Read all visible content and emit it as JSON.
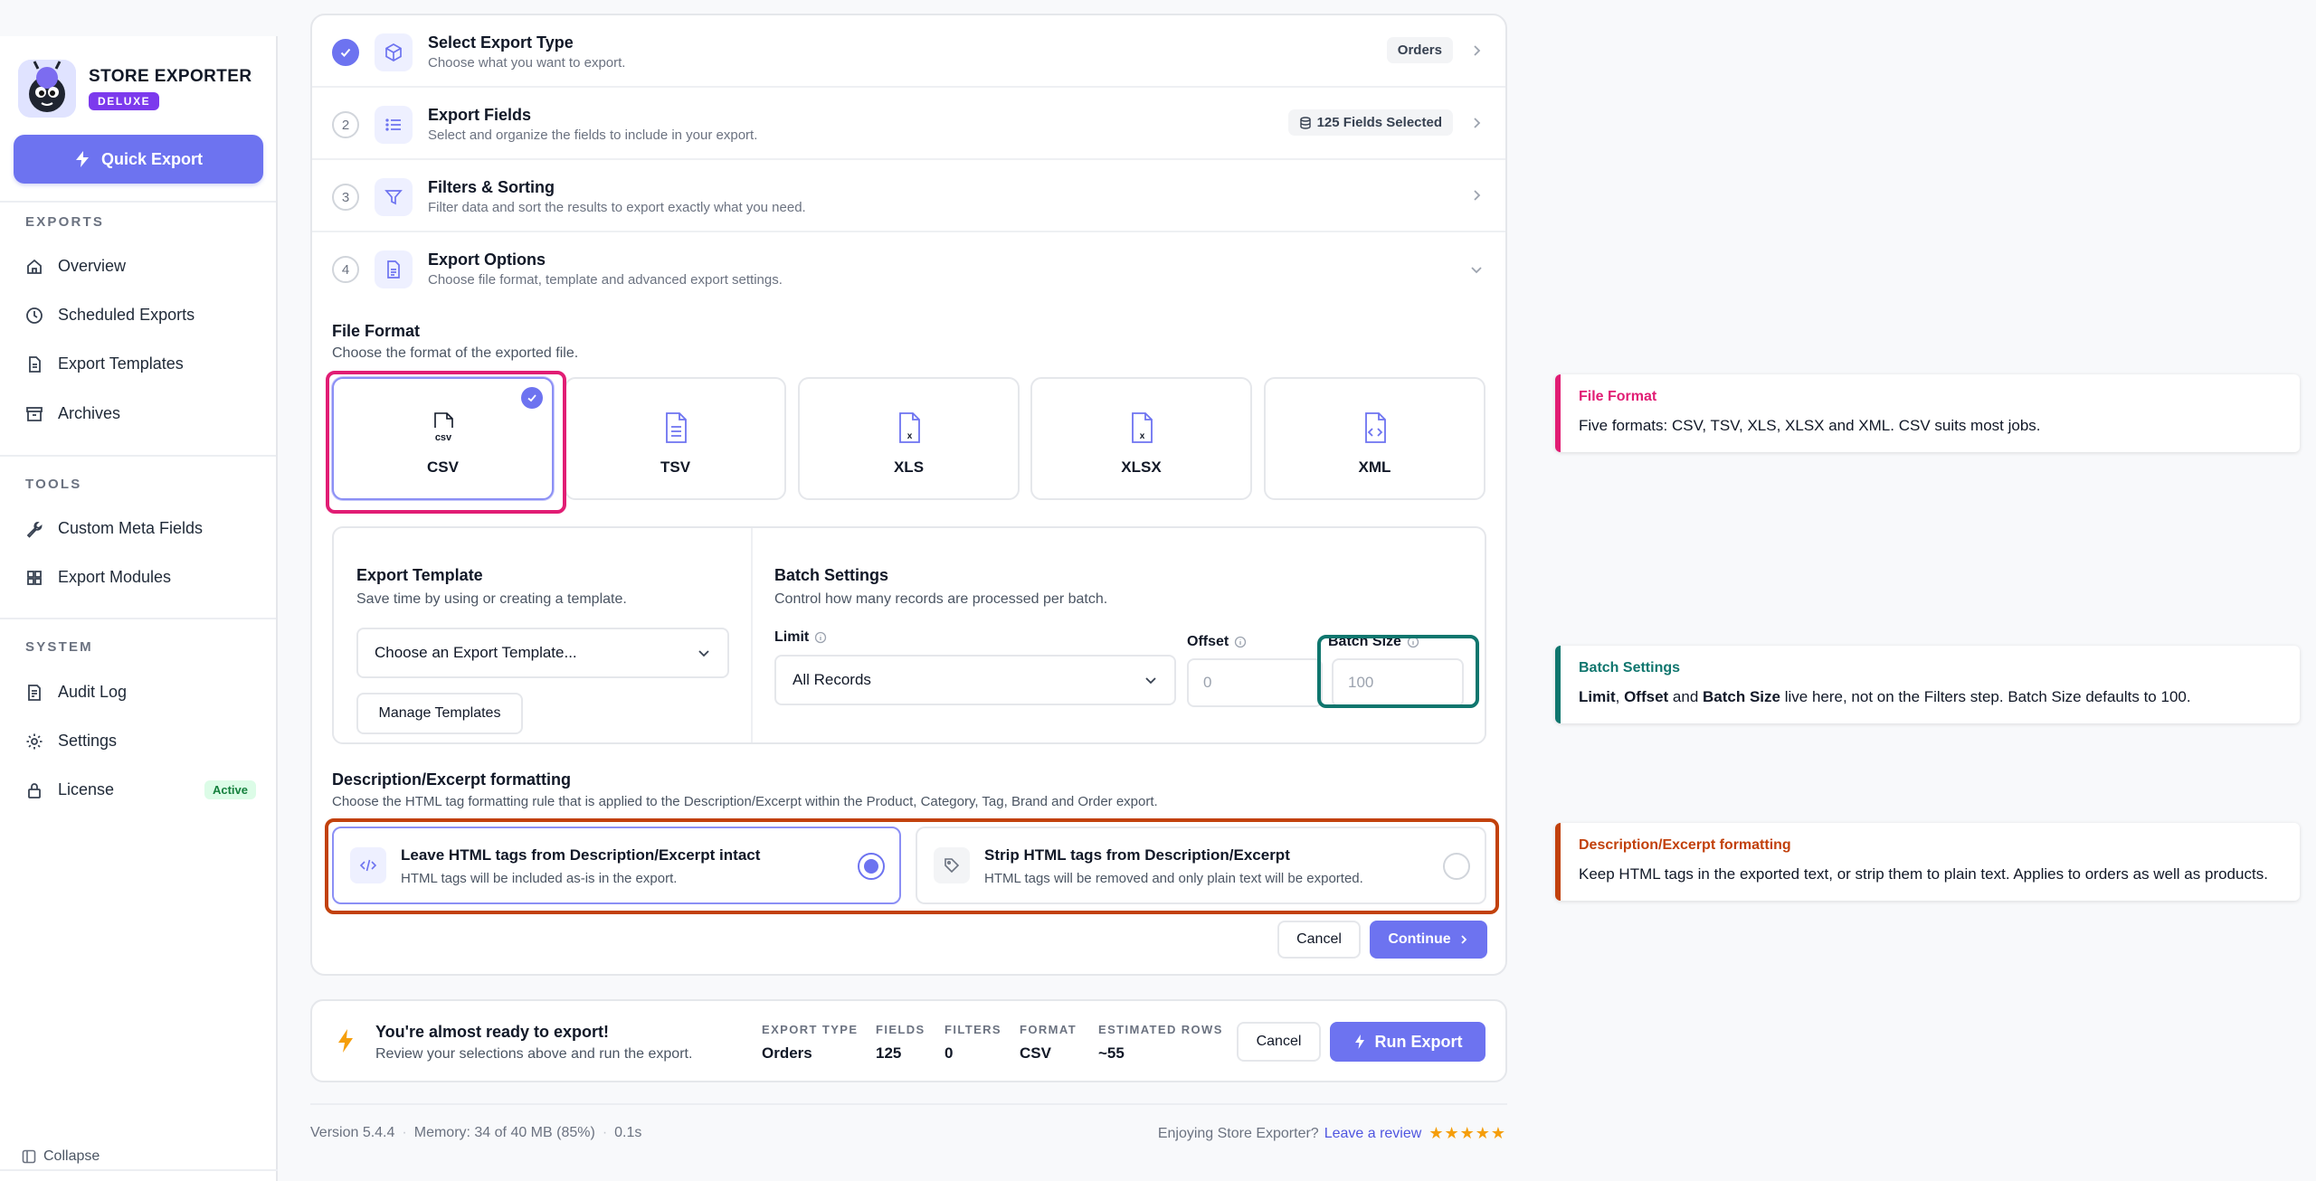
{
  "brand": {
    "name": "STORE EXPORTER",
    "badge": "DELUXE"
  },
  "sidebar": {
    "quick_export": "Quick Export",
    "sections": {
      "exports": "EXPORTS",
      "tools": "TOOLS",
      "system": "SYSTEM"
    },
    "items": {
      "overview": "Overview",
      "scheduled": "Scheduled Exports",
      "templates": "Export Templates",
      "archives": "Archives",
      "meta": "Custom Meta Fields",
      "modules": "Export Modules",
      "audit": "Audit Log",
      "settings": "Settings",
      "license": "License",
      "license_badge": "Active"
    },
    "collapse": "Collapse"
  },
  "steps": [
    {
      "num": "",
      "title": "Select Export Type",
      "desc": "Choose what you want to export.",
      "badge": "Orders"
    },
    {
      "num": "2",
      "title": "Export Fields",
      "desc": "Select and organize the fields to include in your export.",
      "badge": "125 Fields Selected"
    },
    {
      "num": "3",
      "title": "Filters & Sorting",
      "desc": "Filter data and sort the results to export exactly what you need.",
      "badge": ""
    },
    {
      "num": "4",
      "title": "Export Options",
      "desc": "Choose file format, template and advanced export settings.",
      "badge": ""
    }
  ],
  "file_format": {
    "title": "File Format",
    "desc": "Choose the format of the exported file.",
    "options": [
      "CSV",
      "TSV",
      "XLS",
      "XLSX",
      "XML"
    ],
    "selected": "CSV"
  },
  "template": {
    "title": "Export Template",
    "desc": "Save time by using or creating a template.",
    "select_value": "Choose an Export Template...",
    "manage": "Manage Templates"
  },
  "batch": {
    "title": "Batch Settings",
    "desc": "Control how many records are processed per batch.",
    "limit_label": "Limit",
    "limit_value": "All Records",
    "offset_label": "Offset",
    "offset_placeholder": "0",
    "size_label": "Batch Size",
    "size_placeholder": "100"
  },
  "formatting": {
    "title": "Description/Excerpt formatting",
    "desc": "Choose the HTML tag formatting rule that is applied to the Description/Excerpt within the Product, Category, Tag, Brand and Order export.",
    "opt1_title": "Leave HTML tags from Description/Excerpt intact",
    "opt1_desc": "HTML tags will be included as-is in the export.",
    "opt2_title": "Strip HTML tags from Description/Excerpt",
    "opt2_desc": "HTML tags will be removed and only plain text will be exported."
  },
  "actions": {
    "cancel": "Cancel",
    "continue": "Continue"
  },
  "summary": {
    "title": "You're almost ready to export!",
    "desc": "Review your selections above and run the export.",
    "stats": [
      {
        "label": "EXPORT TYPE",
        "value": "Orders"
      },
      {
        "label": "FIELDS",
        "value": "125"
      },
      {
        "label": "FILTERS",
        "value": "0"
      },
      {
        "label": "FORMAT",
        "value": "CSV"
      },
      {
        "label": "ESTIMATED ROWS",
        "value": "~55"
      }
    ],
    "cancel": "Cancel",
    "run": "Run Export"
  },
  "footer": {
    "version": "Version 5.4.4",
    "memory": "Memory: 34 of 40 MB (85%)",
    "time": "0.1s",
    "enjoy": "Enjoying Store Exporter?",
    "review": "Leave a review",
    "stars": "★★★★★",
    "rating": 5
  },
  "annotations": [
    {
      "title": "File Format",
      "body": "Five formats: CSV, TSV, XLS, XLSX and XML. CSV suits most jobs.",
      "color": "#e11d74"
    },
    {
      "title": "Batch Settings",
      "b1": "Limit",
      "t1": ", ",
      "b2": "Offset",
      "t2": " and ",
      "b3": "Batch Size",
      "t3": " live here, not on the Filters step. Batch Size defaults to 100.",
      "color": "#0f766e"
    },
    {
      "title": "Description/Excerpt formatting",
      "body": "Keep HTML tags in the exported text, or strip them to plain text. Applies to orders as well as products.",
      "color": "#c2410c"
    }
  ],
  "colors": {
    "accent": "#6d73f0",
    "pink": "#e11d74",
    "teal": "#0f766e",
    "orange": "#c2410c"
  }
}
